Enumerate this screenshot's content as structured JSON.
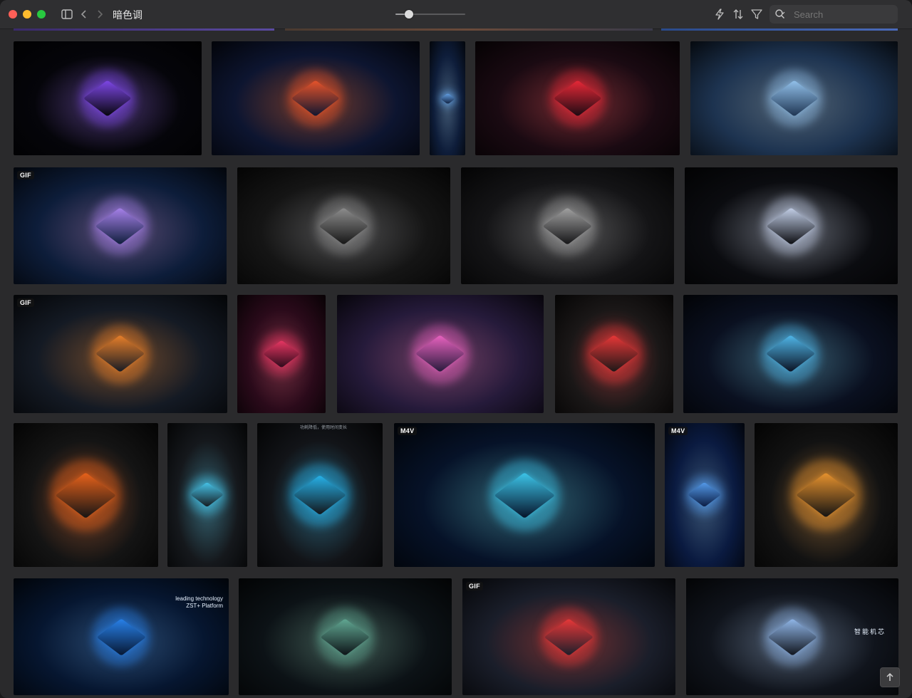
{
  "window": {
    "title": "暗色调"
  },
  "toolbar": {
    "sidebar_toggle_icon": "sidebar-icon",
    "back_icon": "chevron-left-icon",
    "forward_icon": "chevron-right-icon",
    "zoom_level": 0.19,
    "bolt_icon": "lightning-icon",
    "sort_icon": "sort-arrows-icon",
    "filter_icon": "funnel-icon",
    "search": {
      "placeholder": "Search",
      "value": ""
    }
  },
  "grid": {
    "rows": [
      {
        "row": 1,
        "tiles": [
          {
            "label": "",
            "bg": "#05050a",
            "accent": "#8a4dff"
          },
          {
            "label": "",
            "bg": "#0d1530",
            "accent": "#ff5a2a"
          },
          {
            "label": "",
            "bg": "#0e1d3a",
            "accent": "#6fb4ff"
          },
          {
            "label": "",
            "bg": "#1a0a12",
            "accent": "#ff2a3a"
          },
          {
            "label": "",
            "bg": "#1d3350",
            "accent": "#9fd2ff"
          }
        ]
      },
      {
        "row": 2,
        "tiles": [
          {
            "label": "GIF",
            "bg": "#0d1d3a",
            "accent": "#b78cff"
          },
          {
            "label": "",
            "bg": "#151515",
            "accent": "#9a9a9a"
          },
          {
            "label": "",
            "bg": "#141416",
            "accent": "#b0b0b0"
          },
          {
            "label": "",
            "bg": "#0b0c10",
            "accent": "#d6e4ff"
          }
        ]
      },
      {
        "row": 3,
        "tiles": [
          {
            "label": "GIF",
            "bg": "#141a24",
            "accent": "#ff8a2a"
          },
          {
            "label": "",
            "bg": "#2a0a1a",
            "accent": "#ff3a6a"
          },
          {
            "label": "",
            "bg": "#251a3a",
            "accent": "#ff6ad0"
          },
          {
            "label": "",
            "bg": "#1a1717",
            "accent": "#ff3a3a"
          },
          {
            "label": "",
            "bg": "#0a1020",
            "accent": "#56c8ff"
          }
        ]
      },
      {
        "row": 4,
        "tiles": [
          {
            "label": "",
            "bg": "#141414",
            "accent": "#ff6a1a"
          },
          {
            "label": "",
            "bg": "#15181c",
            "accent": "#4ad6ff"
          },
          {
            "label": "",
            "bg": "#121418",
            "accent": "#28c2ff",
            "caption": "功耗降低，使用时间变长"
          },
          {
            "label": "M4V",
            "bg": "#061228",
            "accent": "#40d8ff"
          },
          {
            "label": "M4V",
            "bg": "#0a1a40",
            "accent": "#5aa8ff"
          },
          {
            "label": "",
            "bg": "#121212",
            "accent": "#ffa030"
          }
        ]
      },
      {
        "row": 5,
        "tiles": [
          {
            "label": "",
            "bg": "#061630",
            "accent": "#2a8cff",
            "caption": "leading technology\nZST+ Platform"
          },
          {
            "label": "",
            "bg": "#0c1216",
            "accent": "#6ab8a0"
          },
          {
            "label": "GIF",
            "bg": "#1a1e2a",
            "accent": "#ff3a3a"
          },
          {
            "label": "",
            "bg": "#10141c",
            "accent": "#9ec8ff",
            "caption": "智能机芯"
          }
        ]
      }
    ]
  },
  "scroll_top_icon": "arrow-up-icon"
}
